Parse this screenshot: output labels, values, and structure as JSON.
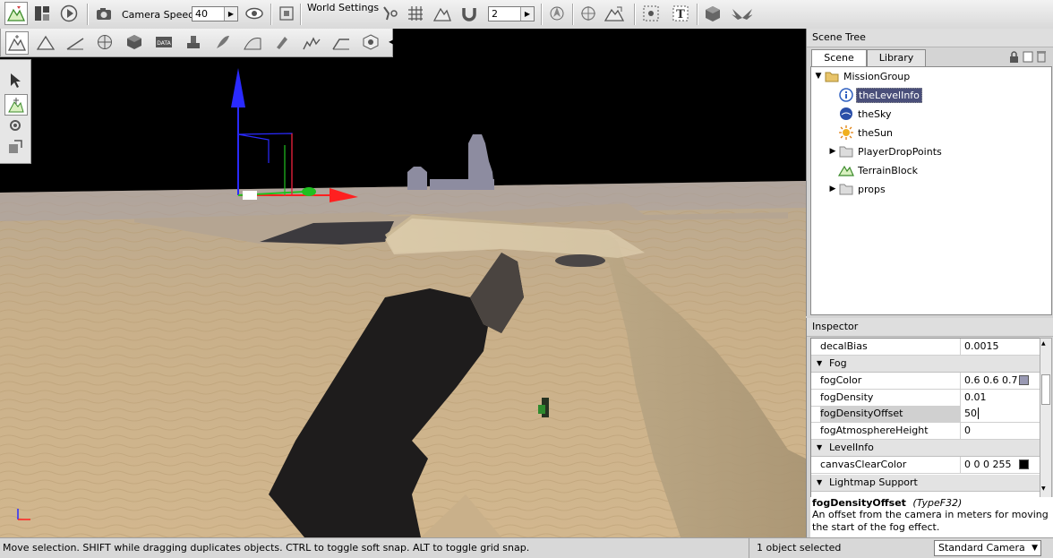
{
  "toolbar": {
    "camera_speed_label": "Camera Speed",
    "camera_speed_value": "40",
    "world_settings_label": "World Settings",
    "snap_value": "2"
  },
  "scene_tree": {
    "title": "Scene Tree",
    "tabs": [
      "Scene",
      "Library"
    ],
    "items": [
      {
        "label": "MissionGroup"
      },
      {
        "label": "theLevelInfo"
      },
      {
        "label": "theSky"
      },
      {
        "label": "theSun"
      },
      {
        "label": "PlayerDropPoints"
      },
      {
        "label": "TerrainBlock"
      },
      {
        "label": "props"
      }
    ]
  },
  "inspector": {
    "title": "Inspector",
    "rows": [
      {
        "name": "decalBias",
        "value": "0.0015"
      },
      {
        "group": "Fog"
      },
      {
        "name": "fogColor",
        "value": "0.6 0.6 0.7"
      },
      {
        "name": "fogDensity",
        "value": "0.01"
      },
      {
        "name": "fogDensityOffset",
        "value": "50"
      },
      {
        "name": "fogAtmosphereHeight",
        "value": "0"
      },
      {
        "group": "LevelInfo"
      },
      {
        "name": "canvasClearColor",
        "value": "0 0 0 255"
      },
      {
        "group": "Lightmap Support"
      }
    ],
    "desc_field": "fogDensityOffset",
    "desc_type": "(TypeF32)",
    "desc_text": "An offset from the camera in meters for moving the start of the fog effect.",
    "colors": {
      "fog": "#9999b3",
      "canvas": "#000000"
    }
  },
  "status": {
    "hint": "Move selection.  SHIFT while dragging duplicates objects.  CTRL to toggle soft snap.  ALT to toggle grid snap.",
    "selection": "1 object selected",
    "camera": "Standard Camera"
  },
  "icons": [
    "terrain-editor-icon",
    "window-layout-icon",
    "play-icon",
    "camera-icon",
    "eye-icon",
    "fit-view-icon",
    "snap-tool-icon",
    "grid-icon",
    "terrain-snap-icon",
    "magnet-icon",
    "bounds-icon",
    "target-icon",
    "terrain-smooth-icon",
    "object-select-icon",
    "text-icon",
    "package-icon",
    "wings-icon"
  ]
}
